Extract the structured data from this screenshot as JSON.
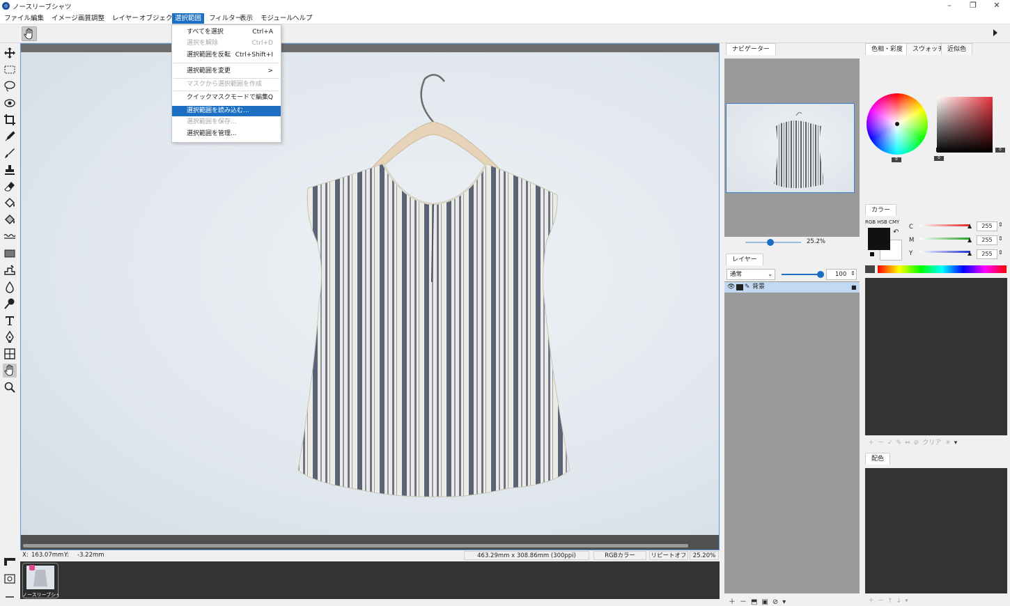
{
  "app": {
    "title": "ノースリーブシャツ",
    "icon": "app-logo-icon"
  },
  "window_controls": [
    "minimize-icon",
    "restore-icon",
    "close-icon"
  ],
  "menubar": [
    "ファイル",
    "編集",
    "イメージ",
    "画質調整",
    "レイヤー",
    "オブジェクト",
    "選択範囲",
    "フィルター",
    "表示",
    "モジュール",
    "ヘルプ"
  ],
  "active_menu": "選択範囲",
  "dropdown": {
    "items": [
      {
        "label": "すべてを選択",
        "shortcut": "Ctrl+A",
        "disabled": false
      },
      {
        "label": "選択を解除",
        "shortcut": "Ctrl+D",
        "disabled": true
      },
      {
        "label": "選択範囲を反転",
        "shortcut": "Ctrl+Shift+I",
        "disabled": false
      },
      {
        "label": "選択範囲を変更",
        "shortcut": ">",
        "disabled": false
      },
      {
        "label": "マスクから選択範囲を作成",
        "shortcut": "",
        "disabled": true
      },
      {
        "label": "クイックマスクモードで編集",
        "shortcut": "Q",
        "disabled": false
      },
      {
        "label": "選択範囲を読み込む...",
        "shortcut": "",
        "disabled": false,
        "highlighted": true
      },
      {
        "label": "選択範囲を保存...",
        "shortcut": "",
        "disabled": true
      },
      {
        "label": "選択範囲を管理...",
        "shortcut": "",
        "disabled": false
      }
    ]
  },
  "tools": [
    "move-tool-icon",
    "rect-select-icon",
    "lasso-icon",
    "magic-select-icon",
    "crop-icon",
    "eyedropper-icon",
    "brush-icon",
    "stamp-icon",
    "eraser-icon",
    "fill-bucket-icon",
    "gradient-bucket-icon",
    "wave-icon",
    "shape-rect-icon",
    "object-stamp-icon",
    "drop-icon",
    "dodge-icon",
    "text-icon",
    "pen-icon",
    "grid-transform-icon",
    "hand-icon",
    "zoom-icon"
  ],
  "status": {
    "x_label": "X:",
    "x_value": "163.07mm",
    "y_label": "Y:",
    "y_value": "-3.22mm",
    "doc_size": "463.29mm x 308.86mm (300ppi)",
    "color_mode": "RGBカラー",
    "repeat": "リピートオフ",
    "zoom": "25.20%"
  },
  "thumbnail": {
    "label": "ノースリーブシャツ"
  },
  "navigator": {
    "tab": "ナビゲーター",
    "zoom": "25.2%",
    "zoom_level": 0.45
  },
  "layers": {
    "tab": "レイヤー",
    "blend_mode": "通常",
    "opacity": "100",
    "items": [
      {
        "name": "背景",
        "locked": true
      }
    ]
  },
  "color_tabs": [
    "色相・彩度",
    "スウォッチ",
    "近似色"
  ],
  "color_wheel_tags": [
    "0",
    "0",
    "0"
  ],
  "color_panel": {
    "tab": "カラー",
    "modes": "RGB HSB CMY",
    "sliders": [
      {
        "label": "C",
        "value": "255",
        "color": "#e02020"
      },
      {
        "label": "M",
        "value": "255",
        "color": "#1fa01f"
      },
      {
        "label": "Y",
        "value": "255",
        "color": "#2030d0"
      }
    ],
    "foreground": "#111111",
    "background": "#ffffff"
  },
  "palette_toolbar": {
    "clear_label": "クリア"
  },
  "haishoku": {
    "tab": "配色"
  }
}
